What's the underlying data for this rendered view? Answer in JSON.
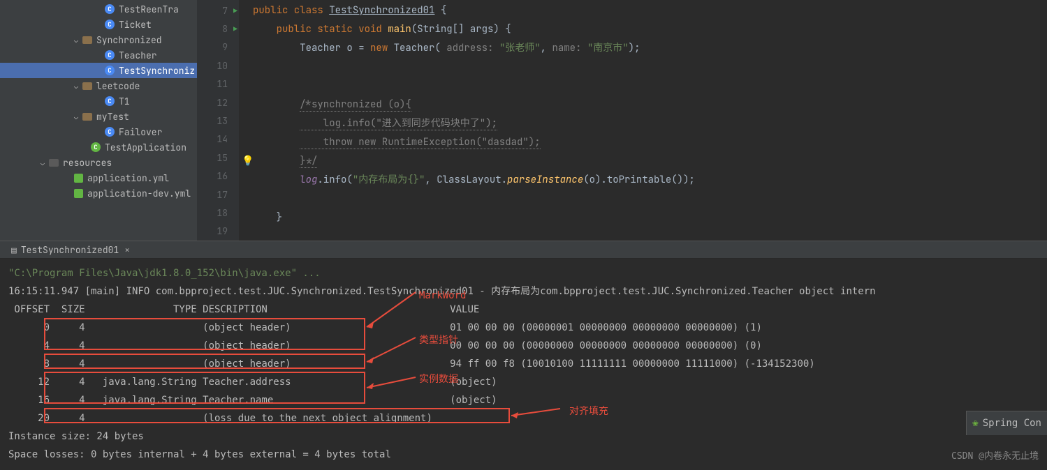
{
  "tree": {
    "items": [
      {
        "label": "TestReenTra",
        "icon": "class",
        "indent": 5
      },
      {
        "label": "Ticket",
        "icon": "class",
        "indent": 5
      },
      {
        "label": "Synchronized",
        "icon": "folder",
        "indent": 3,
        "chev": "v"
      },
      {
        "label": "Teacher",
        "icon": "class",
        "indent": 5
      },
      {
        "label": "TestSynchroniz",
        "icon": "class",
        "indent": 5,
        "selected": true
      },
      {
        "label": "leetcode",
        "icon": "folder",
        "indent": 3,
        "chev": "v"
      },
      {
        "label": "T1",
        "icon": "class",
        "indent": 5
      },
      {
        "label": "myTest",
        "icon": "folder",
        "indent": 3,
        "chev": "v"
      },
      {
        "label": "Failover",
        "icon": "class",
        "indent": 5
      },
      {
        "label": "TestApplication",
        "icon": "class-green",
        "indent": 4
      },
      {
        "label": "resources",
        "icon": "folder-dark",
        "indent": 1,
        "chev": "v"
      },
      {
        "label": "application.yml",
        "icon": "yml",
        "indent": 3
      },
      {
        "label": "application-dev.yml",
        "icon": "yml",
        "indent": 3
      }
    ]
  },
  "gutter": {
    "lines": [
      7,
      8,
      9,
      10,
      11,
      12,
      13,
      14,
      15,
      16,
      17,
      18,
      19
    ],
    "run_lines": [
      7,
      8
    ]
  },
  "code": {
    "l7": {
      "kw1": "public class",
      "cls": "TestSynchronized01",
      "b": "{"
    },
    "l8": {
      "kw1": "public static void",
      "m": "main",
      "p": "(String[] args) {"
    },
    "l9": {
      "t": "Teacher o = ",
      "kw": "new",
      "c": " Teacher(",
      "h1": " address: ",
      "s1": "\"张老师\"",
      "cm": ", ",
      "h2": "name: ",
      "s2": "\"南京市\"",
      "end": ");"
    },
    "l12": "/*synchronized (o){",
    "l13": "    log.info(\"进入到同步代码块中了\");",
    "l14": "    throw new RuntimeException(\"dasdad\");",
    "l15": "}*/",
    "l16": {
      "v": "log",
      "m": ".info(",
      "s": "\"内存布局为{}\"",
      "r": ", ClassLayout.",
      "sm": "parseInstance",
      "r2": "(o).toPrintable());"
    },
    "l18": "}"
  },
  "tab": {
    "label": "TestSynchronized01"
  },
  "console": {
    "l1": "\"C:\\Program Files\\Java\\jdk1.8.0_152\\bin\\java.exe\" ...",
    "l2": "16:15:11.947 [main] INFO com.bpproject.test.JUC.Synchronized.TestSynchronized01 - 内存布局为com.bpproject.test.JUC.Synchronized.Teacher object intern",
    "l3": " OFFSET  SIZE               TYPE DESCRIPTION                               VALUE",
    "l4": "      0     4                    (object header)                           01 00 00 00 (00000001 00000000 00000000 00000000) (1)",
    "l5": "      4     4                    (object header)                           00 00 00 00 (00000000 00000000 00000000 00000000) (0)",
    "l6": "      8     4                    (object header)                           94 ff 00 f8 (10010100 11111111 00000000 11111000) (-134152300)",
    "l7": "     12     4   java.lang.String Teacher.address                           (object)",
    "l8": "     16     4   java.lang.String Teacher.name                              (object)",
    "l9": "     20     4                    (loss due to the next object alignment)",
    "l10": "Instance size: 24 bytes",
    "l11": "Space losses: 0 bytes internal + 4 bytes external = 4 bytes total"
  },
  "annotations": {
    "markword": "MarkWord",
    "type_ptr": "类型指针",
    "instance": "实例数据",
    "padding": "对齐填充"
  },
  "watermark": "CSDN @内卷永无止境",
  "spring": "Spring Con"
}
